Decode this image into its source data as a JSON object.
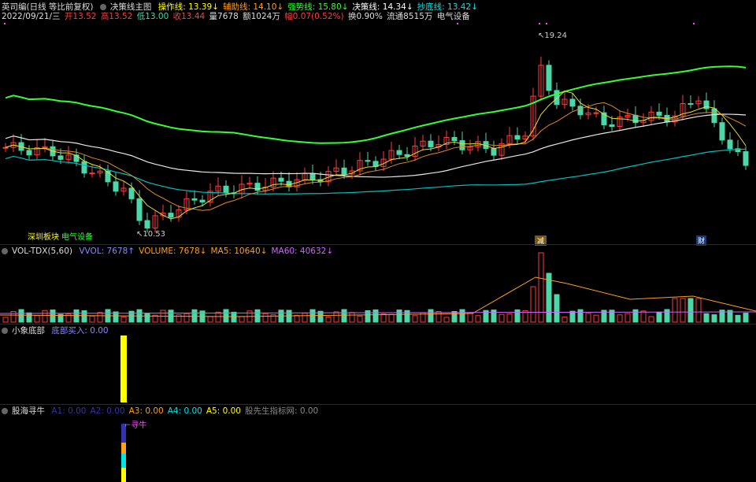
{
  "header": {
    "title": "英司编(日线 等比前复权)",
    "main_indicator": "决策线主图",
    "lines": [
      {
        "label": "操作线",
        "value": "13.39",
        "arrow": "↓",
        "color": "#ffff00"
      },
      {
        "label": "辅助线",
        "value": "14.10",
        "arrow": "↓",
        "color": "#ff9f1a"
      },
      {
        "label": "强势线",
        "value": "15.80",
        "arrow": "↓",
        "color": "#33ff33"
      },
      {
        "label": "决策线",
        "value": "14.34",
        "arrow": "↓",
        "color": "#ffffff"
      },
      {
        "label": "抄底线",
        "value": "13.42",
        "arrow": "↓",
        "color": "#00e5e5"
      }
    ]
  },
  "quote": {
    "date": "2022/09/21/三",
    "open": "开13.52",
    "high": "高13.52",
    "low": "低13.00",
    "close": "收13.44",
    "volume": "量7678",
    "amount": "额1024万",
    "change": "幅0.07(0.52%)",
    "turnover": "换0.90%",
    "float": "流通8515万",
    "sector": "电气设备"
  },
  "annotations": {
    "high_price": "19.24",
    "low_price": "10.53",
    "tag_board": "深圳板块",
    "tag_sector": "电气设备",
    "tag_reduce": "减",
    "tag_finance": "财"
  },
  "volume_panel": {
    "name": "VOL-TDX(5,60)",
    "items": [
      {
        "text": "VVOL: 7678",
        "arrow": "↑",
        "color": "#8888ff"
      },
      {
        "text": "VOLUME: 7678",
        "arrow": "↓",
        "color": "#ff9f1a"
      },
      {
        "text": "MA5: 10640",
        "arrow": "↓",
        "color": "#ff9f1a"
      },
      {
        "text": "MA60: 40632",
        "arrow": "↓",
        "color": "#cc66ff"
      }
    ]
  },
  "bottom_panel": {
    "name": "小象底部",
    "label": "底部买入: 0.00"
  },
  "signal_panel": {
    "name": "股海寻牛",
    "items": [
      {
        "text": "A1: 0.00",
        "color": "#3333aa"
      },
      {
        "text": "A2: 0.00",
        "color": "#3333aa"
      },
      {
        "text": "A3: 0.00",
        "color": "#ff9f1a"
      },
      {
        "text": "A4: 0.00",
        "color": "#00e5e5"
      },
      {
        "text": "A5: 0.00",
        "color": "#ffff00"
      },
      {
        "text": "股先生指标网: 0.00",
        "color": "#888888"
      }
    ],
    "signal_label": "寻牛"
  },
  "colors": {
    "up": "#ff3b3b",
    "down": "#4ed6a8",
    "strong_line": "#33ff33",
    "decision_line": "#e8e8e8",
    "bottom_line": "#00c0c0",
    "aux_line": "#e08a2a",
    "op_line": "#e8e030"
  }
}
